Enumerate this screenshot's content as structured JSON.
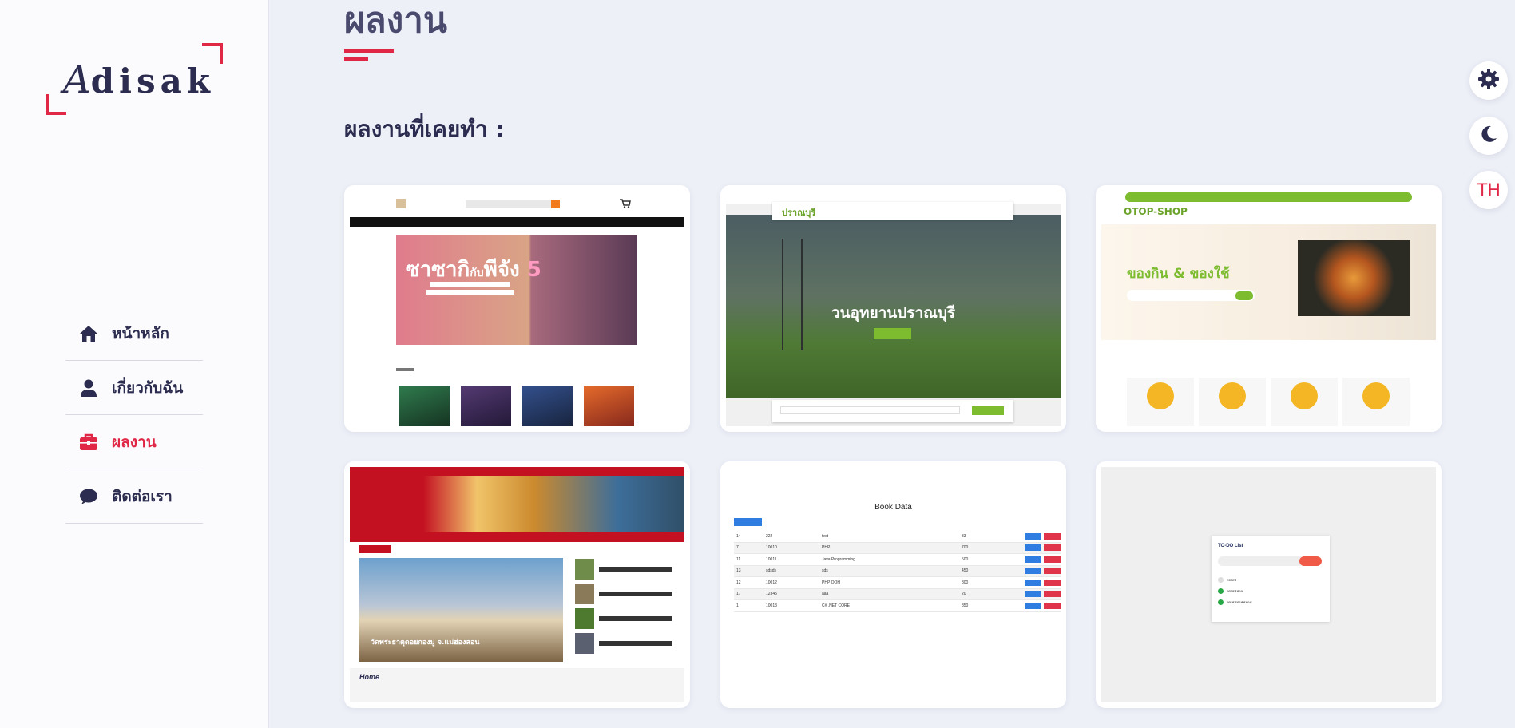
{
  "sidebar": {
    "logo": {
      "first_letter": "A",
      "rest": "disak"
    },
    "nav": [
      {
        "label": "หน้าหลัก",
        "icon": "home-icon",
        "active": false
      },
      {
        "label": "เกี่ยวกับฉัน",
        "icon": "user-icon",
        "active": false
      },
      {
        "label": "ผลงาน",
        "icon": "briefcase-icon",
        "active": true
      },
      {
        "label": "ติดต่อเรา",
        "icon": "chat-icon",
        "active": false
      }
    ]
  },
  "main": {
    "title": "ผลงาน",
    "section_heading": "ผลงานที่เคยทำ :",
    "projects": [
      {
        "banner_title": "ซาซากิ",
        "banner_mid": "กับ",
        "banner_title2": "พีจัง",
        "banner_number": "5"
      },
      {
        "logo": "ปราณบุรี",
        "hero_title": "วนอุทยานปราณบุรี"
      },
      {
        "logo": "OTOP-SHOP",
        "hero_title": "ของกิน & ของใช้"
      },
      {
        "caption": "วัดพระธาตุดอยกองมู จ.แม่ฮ่องสอน",
        "footer_label": "Home"
      },
      {
        "title": "Book Data",
        "rows": [
          [
            "14",
            "222",
            "test",
            "33"
          ],
          [
            "7",
            "10010",
            "PHP",
            "700"
          ],
          [
            "11",
            "10011",
            "Java Programming",
            "500"
          ],
          [
            "13",
            "sdsds",
            "sds",
            "450"
          ],
          [
            "12",
            "10012",
            "PHP OOH",
            "800"
          ],
          [
            "17",
            "12345",
            "aaa",
            "20"
          ],
          [
            "1",
            "10013",
            "C# .NET CORE",
            "850"
          ]
        ]
      },
      {
        "title": "TO-DO List",
        "items": [
          "ฟฟฟฟ",
          "ฟฟฟฟฟดฟ",
          "ฟดฟฟฟดฟฟฟดฟ"
        ]
      }
    ]
  },
  "floating": {
    "settings_icon": "gear-icon",
    "theme_icon": "moon-icon",
    "language": "TH"
  },
  "colors": {
    "accent": "#e02846",
    "text": "#2b2c4f",
    "background": "#eef0f8"
  }
}
